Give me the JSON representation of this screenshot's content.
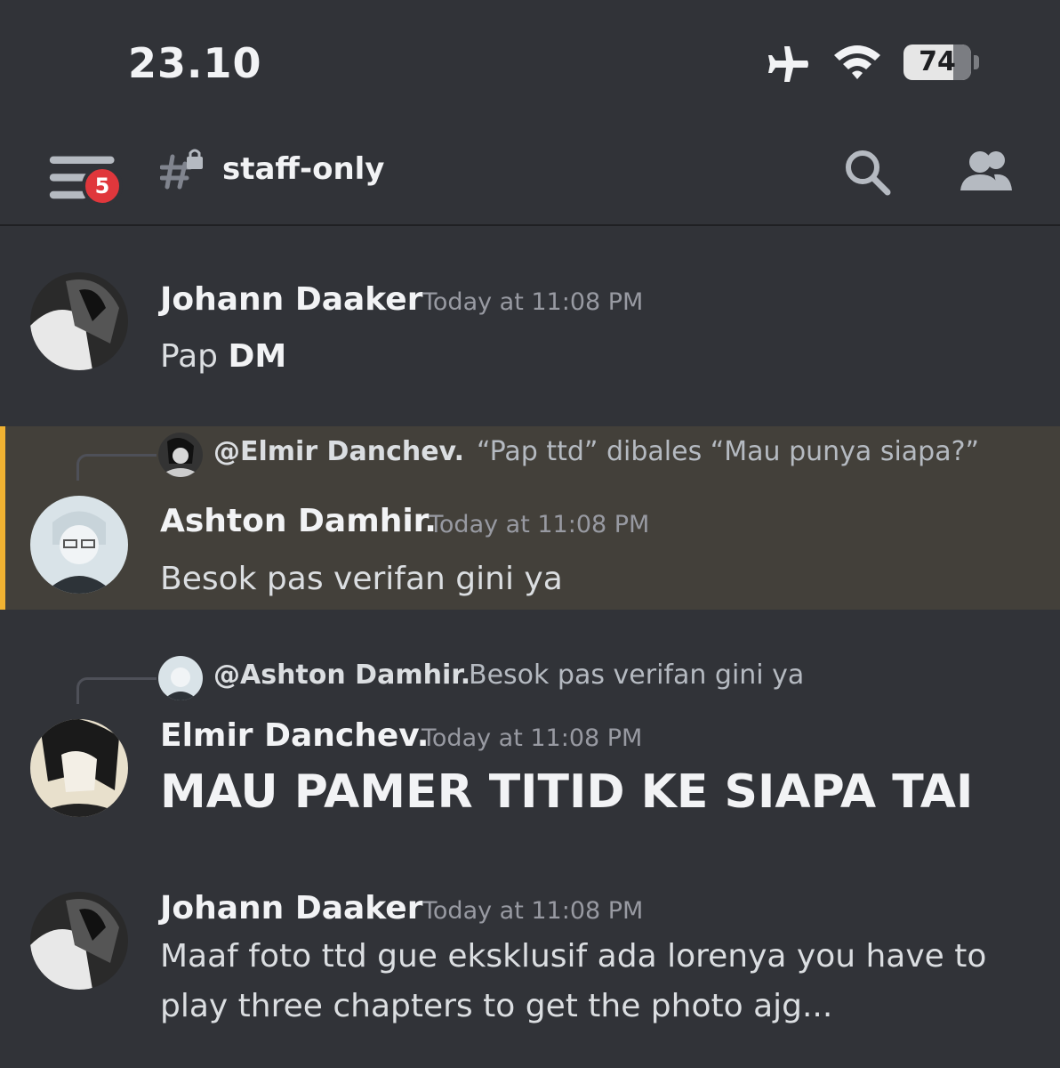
{
  "status": {
    "time": "23.10",
    "battery": "74",
    "icons": [
      "airplane-mode-icon",
      "wifi-icon",
      "battery-icon"
    ]
  },
  "header": {
    "unread_badge": "5",
    "channel_name": "staff-only",
    "icons": [
      "hamburger-menu-icon",
      "locked-channel-icon",
      "search-icon",
      "members-icon"
    ]
  },
  "messages": [
    {
      "author": "Johann Daaker",
      "timestamp": "Today at 11:08 PM",
      "text_plain": "Pap ",
      "text_bold": "DM"
    },
    {
      "reply_to_user": "@Elmir Danchev.",
      "reply_preview": "“Pap ttd” dibales “Mau punya siapa?”",
      "author": "Ashton Damhir.",
      "timestamp": "Today at 11:08 PM",
      "text": "Besok pas verifan gini ya",
      "highlighted": true
    },
    {
      "reply_to_user": "@Ashton Damhir.",
      "reply_preview": "Besok pas verifan gini ya",
      "author": "Elmir Danchev.",
      "timestamp": "Today at 11:08 PM",
      "text": "MAU PAMER TITID KE SIAPA TAI"
    },
    {
      "author": "Johann Daaker",
      "timestamp": "Today at 11:08 PM",
      "text_line1": "Maaf foto ttd gue eksklusif ada lorenya you have to",
      "text_line2": "play three chapters to get the photo ajg..."
    }
  ],
  "colors": {
    "background": "#313338",
    "highlight": "#43403a",
    "highlight_bar": "#f0b232",
    "badge": "#e0373c"
  }
}
